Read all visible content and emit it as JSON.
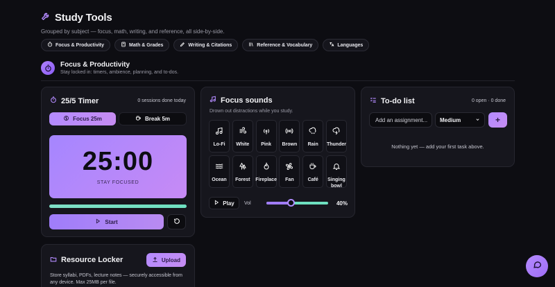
{
  "header": {
    "title": "Study Tools",
    "subtitle": "Grouped by subject — focus, math, writing, and reference, all side-by-side."
  },
  "pills": [
    {
      "label": "Focus & Productivity",
      "icon": "timer-icon"
    },
    {
      "label": "Math & Grades",
      "icon": "calculator-icon"
    },
    {
      "label": "Writing & Citations",
      "icon": "pen-icon"
    },
    {
      "label": "Reference & Vocabulary",
      "icon": "library-icon"
    },
    {
      "label": "Languages",
      "icon": "translate-icon"
    }
  ],
  "section": {
    "title": "Focus & Productivity",
    "subtitle": "Stay locked in: timers, ambience, planning, and to-dos."
  },
  "timer": {
    "title": "25/5 Timer",
    "sessions": "0 sessions done today",
    "focus_tab": "Focus 25m",
    "break_tab": "Break 5m",
    "time": "25:00",
    "status": "STAY FOCUSED",
    "progress": 1.0,
    "start_label": "Start"
  },
  "sounds": {
    "title": "Focus sounds",
    "subtitle": "Drown out distractions while you study.",
    "tiles": [
      {
        "label": "Lo-Fi",
        "icon": "music-note-icon"
      },
      {
        "label": "White",
        "icon": "wind-icon"
      },
      {
        "label": "Pink",
        "icon": "radio-waves-icon"
      },
      {
        "label": "Brown",
        "icon": "broadcast-icon"
      },
      {
        "label": "Rain",
        "icon": "cloud-rain-icon"
      },
      {
        "label": "Thunder",
        "icon": "cloud-lightning-icon"
      },
      {
        "label": "Ocean",
        "icon": "waves-icon"
      },
      {
        "label": "Forest",
        "icon": "trees-icon"
      },
      {
        "label": "Fireplace",
        "icon": "flame-icon"
      },
      {
        "label": "Fan",
        "icon": "fan-icon"
      },
      {
        "label": "Café",
        "icon": "coffee-icon"
      },
      {
        "label": "Singing bowl",
        "icon": "bell-icon"
      }
    ],
    "play_label": "Play",
    "vol_label": "Vol",
    "volume": 0.4,
    "volume_text": "40%"
  },
  "todo": {
    "title": "To-do list",
    "count": "0 open · 0 done",
    "input_placeholder": "Add an assignment...",
    "priority": "Medium",
    "add_label": "+",
    "empty": "Nothing yet — add your first task above."
  },
  "locker": {
    "title": "Resource Locker",
    "upload_label": "Upload",
    "description": "Store syllabi, PDFs, lecture notes — securely accessible from any device. Max 25MB per file."
  },
  "colors": {
    "accent": "#b48bff",
    "accent_pink": "#c68cf2",
    "teal": "#6ee0c0",
    "background": "#0d0d12",
    "card": "#16161d"
  }
}
